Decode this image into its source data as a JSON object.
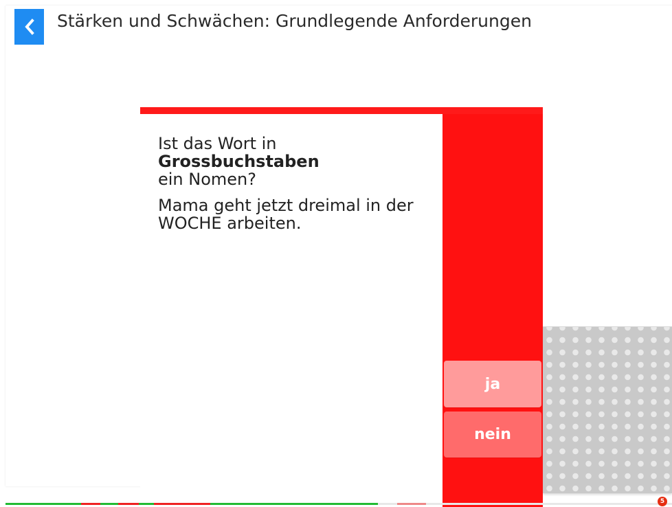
{
  "header": {
    "back_icon": "chevron-left-icon",
    "title": "Stärken und Schwächen: Grundlegende Anforderungen"
  },
  "question": {
    "prompt_prefix": "Ist das Wort in ",
    "prompt_bold": "Grossbuchstaben",
    "prompt_suffix": "ein Nomen?",
    "sentence": "Mama geht jetzt dreimal in der WOCHE arbeiten."
  },
  "answers": {
    "yes_label": "ja",
    "no_label": "nein"
  },
  "footer": {
    "counter": "5"
  },
  "colors": {
    "accent_blue": "#1f8cf2",
    "card_red": "#ff1111",
    "button_light": "#ff9b9b",
    "button_mid": "#ff6b6b",
    "progress_green": "#22bb33",
    "progress_red": "#ee2222"
  }
}
